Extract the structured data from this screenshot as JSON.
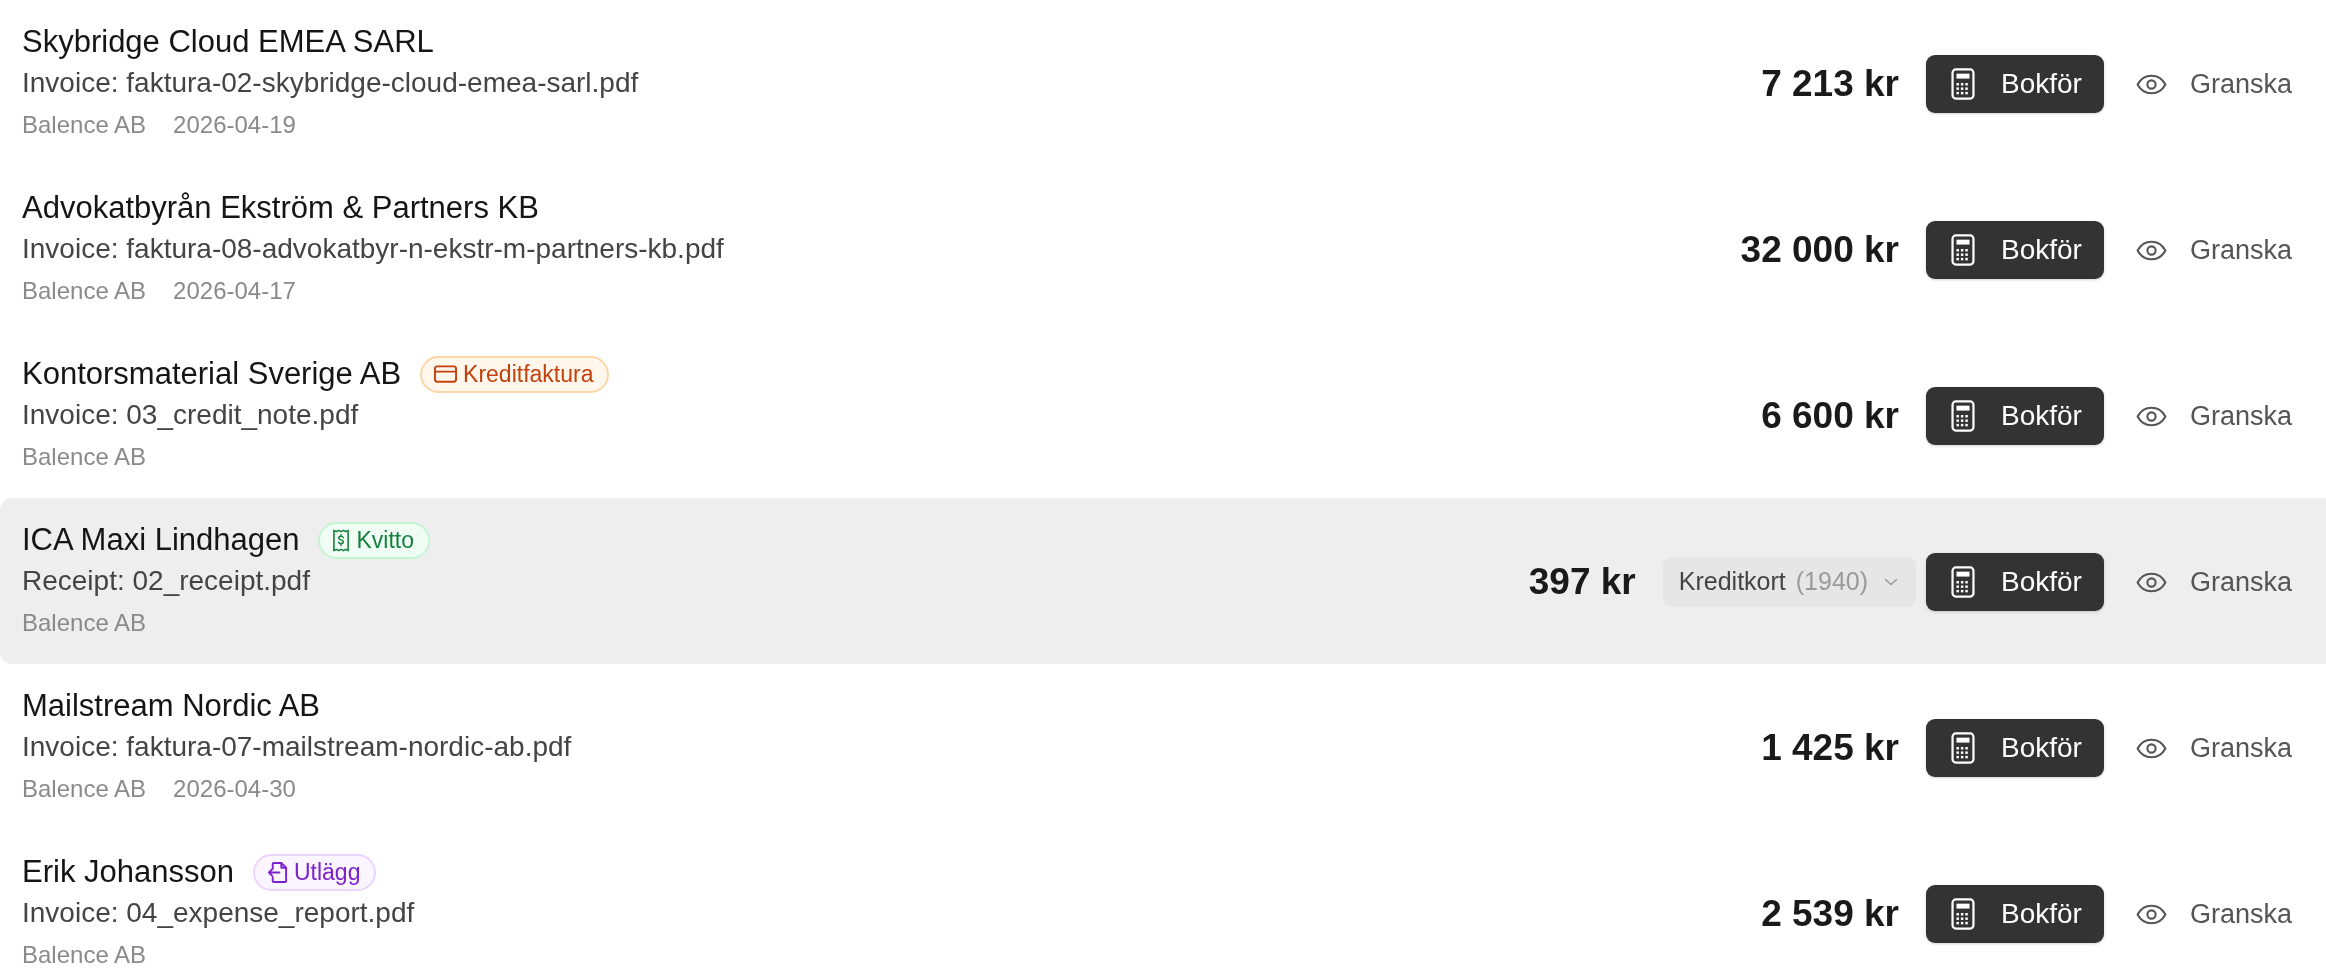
{
  "rows": [
    {
      "title": "Skybridge Cloud EMEA SARL",
      "document": "Invoice: faktura-02-skybridge-cloud-emea-sarl.pdf",
      "company": "Balence AB",
      "date": "2026-04-19",
      "amount": "7 213 kr",
      "post_button": "Bokför",
      "review_button": "Granska",
      "highlighted": false
    },
    {
      "title": "Advokatbyrån Ekström & Partners KB",
      "document": "Invoice: faktura-08-advokatbyr-n-ekstr-m-partners-kb.pdf",
      "company": "Balence AB",
      "date": "2026-04-17",
      "amount": "32 000 kr",
      "post_button": "Bokför",
      "review_button": "Granska",
      "highlighted": false
    },
    {
      "title": "Kontorsmaterial Sverige AB",
      "tag": {
        "kind": "credit_note",
        "label": "Kreditfaktura"
      },
      "document": "Invoice: 03_credit_note.pdf",
      "company": "Balence AB",
      "amount": "6 600 kr",
      "post_button": "Bokför",
      "review_button": "Granska",
      "highlighted": false
    },
    {
      "title": "ICA Maxi Lindhagen",
      "tag": {
        "kind": "receipt",
        "label": "Kvitto"
      },
      "document": "Receipt: 02_receipt.pdf",
      "company": "Balence AB",
      "amount": "397 kr",
      "account_select": {
        "value": "Kreditkort",
        "account": "(1940)"
      },
      "post_button": "Bokför",
      "review_button": "Granska",
      "highlighted": true
    },
    {
      "title": "Mailstream Nordic AB",
      "document": "Invoice: faktura-07-mailstream-nordic-ab.pdf",
      "company": "Balence AB",
      "date": "2026-04-30",
      "amount": "1 425 kr",
      "post_button": "Bokför",
      "review_button": "Granska",
      "highlighted": false
    },
    {
      "title": "Erik Johansson",
      "tag": {
        "kind": "expense",
        "label": "Utlägg"
      },
      "document": "Invoice: 04_expense_report.pdf",
      "company": "Balence AB",
      "amount": "2 539 kr",
      "post_button": "Bokför",
      "review_button": "Granska",
      "highlighted": false
    }
  ]
}
